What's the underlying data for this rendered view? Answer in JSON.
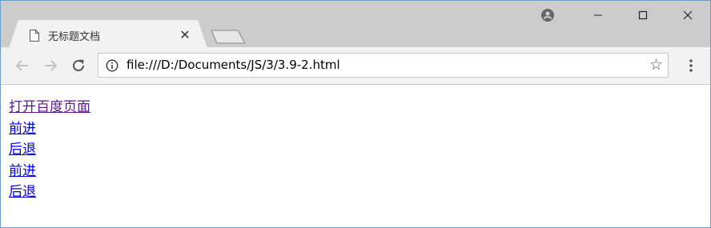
{
  "tab": {
    "title": "无标题文档",
    "close_glyph": "✕",
    "icon": "document-icon"
  },
  "toolbar": {
    "url": "file:///D:/Documents/JS/3/3.9-2.html",
    "bookmark_glyph": "☆",
    "icons": [
      "back-icon",
      "forward-icon",
      "reload-icon",
      "info-icon",
      "star-icon",
      "more-vert-icon"
    ]
  },
  "window_controls": [
    "minimize-icon",
    "maximize-icon",
    "close-icon"
  ],
  "page": {
    "links": [
      {
        "label": "打开百度页面",
        "state": "visited"
      },
      {
        "label": "前进",
        "state": "unvisited"
      },
      {
        "label": "后退",
        "state": "unvisited"
      },
      {
        "label": "前进",
        "state": "unvisited"
      },
      {
        "label": "后退",
        "state": "unvisited"
      }
    ]
  },
  "colors": {
    "titlebar": "#cccccc",
    "toolbar": "#f2f2f2",
    "visited_link": "#551a8b",
    "link": "#0000ee",
    "window_border": "#6f9ac9"
  }
}
